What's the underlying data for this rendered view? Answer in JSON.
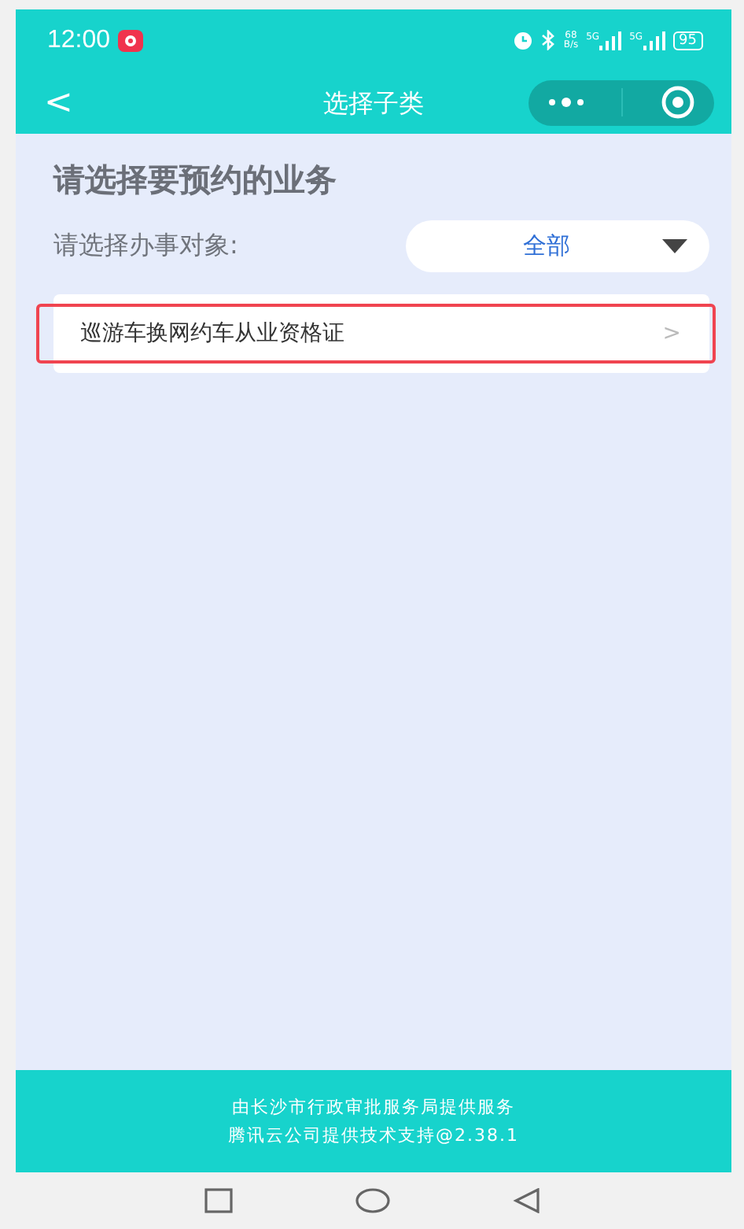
{
  "status_bar": {
    "time": "12:00",
    "net_speed": [
      "68",
      "B/s"
    ],
    "signals": [
      "5G",
      "5G"
    ],
    "battery": "95"
  },
  "nav": {
    "back": "<",
    "title": "选择子类"
  },
  "heading": "请选择要预约的业务",
  "filter": {
    "label": "请选择办事对象:",
    "value": "全部"
  },
  "items": [
    {
      "label": "巡游车换网约车从业资格证",
      "chevron": ">",
      "highlighted": true
    }
  ],
  "footer": [
    "由长沙市行政审批服务局提供服务",
    "腾讯云公司提供技术支持@2.38.1"
  ]
}
